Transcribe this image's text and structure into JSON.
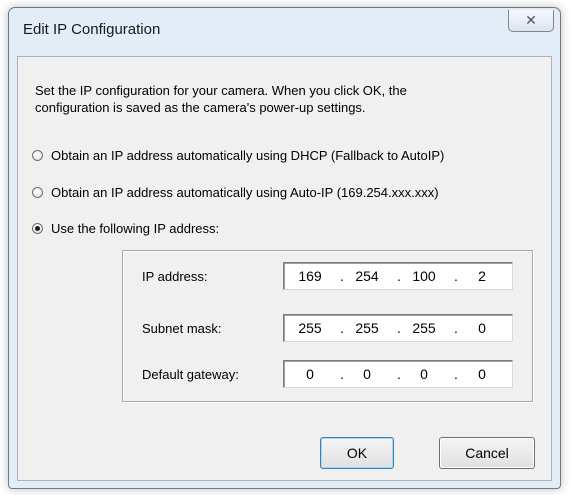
{
  "window": {
    "title": "Edit IP Configuration",
    "close_glyph": "✕"
  },
  "intro": {
    "line1": "Set the IP configuration for your camera.  When you click OK, the",
    "line2": "configuration is saved as the camera's power-up settings."
  },
  "options": [
    {
      "label": "Obtain an IP address automatically using DHCP (Fallback to AutoIP)",
      "checked": false
    },
    {
      "label": "Obtain an IP address automatically using Auto-IP (169.254.xxx.xxx)",
      "checked": false
    },
    {
      "label": "Use the following IP address:",
      "checked": true
    }
  ],
  "fields": {
    "ip": {
      "label": "IP address:",
      "octets": [
        "169",
        "254",
        "100",
        "2"
      ]
    },
    "subnet": {
      "label": "Subnet mask:",
      "octets": [
        "255",
        "255",
        "255",
        "0"
      ]
    },
    "gateway": {
      "label": "Default gateway:",
      "octets": [
        "0",
        "0",
        "0",
        "0"
      ]
    },
    "separator": "."
  },
  "buttons": {
    "ok": "OK",
    "cancel": "Cancel"
  },
  "icons": {
    "close": "close-icon",
    "radio": "radio-button"
  }
}
